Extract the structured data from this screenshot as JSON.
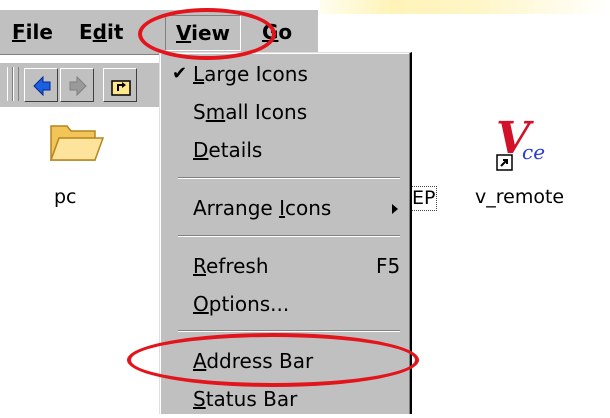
{
  "menubar": {
    "file": {
      "hot": "F",
      "rest": "ile"
    },
    "edit": {
      "pre": "E",
      "hot": "d",
      "rest": "it"
    },
    "view": {
      "hot": "V",
      "rest": "iew"
    },
    "go": {
      "hot": "G",
      "rest": "o"
    }
  },
  "toolbar": {
    "back_icon": "back-arrow-icon",
    "forward_icon": "forward-arrow-icon",
    "up_icon": "up-folder-icon"
  },
  "desktop": {
    "pc_label": "pc",
    "ep_label": "EP",
    "vremote_label": "v_remote"
  },
  "view_menu": {
    "large_icons": {
      "check": "✔",
      "pre": "",
      "hot": "L",
      "rest": "arge Icons"
    },
    "small_icons": {
      "pre": "S",
      "hot": "m",
      "rest": "all Icons"
    },
    "details": {
      "pre": "",
      "hot": "D",
      "rest": "etails"
    },
    "arrange_icons": {
      "pre": "Arrange ",
      "hot": "I",
      "rest": "cons"
    },
    "refresh": {
      "pre": "",
      "hot": "R",
      "rest": "efresh",
      "shortcut": "F5"
    },
    "options": {
      "pre": "",
      "hot": "O",
      "rest": "ptions..."
    },
    "address_bar": {
      "pre": "",
      "hot": "A",
      "rest": "ddress Bar"
    },
    "status_bar": {
      "pre": "",
      "hot": "S",
      "rest": "tatus Bar"
    }
  },
  "colors": {
    "annotation": "#e3141b",
    "menu_bg": "#c0c0c0"
  }
}
